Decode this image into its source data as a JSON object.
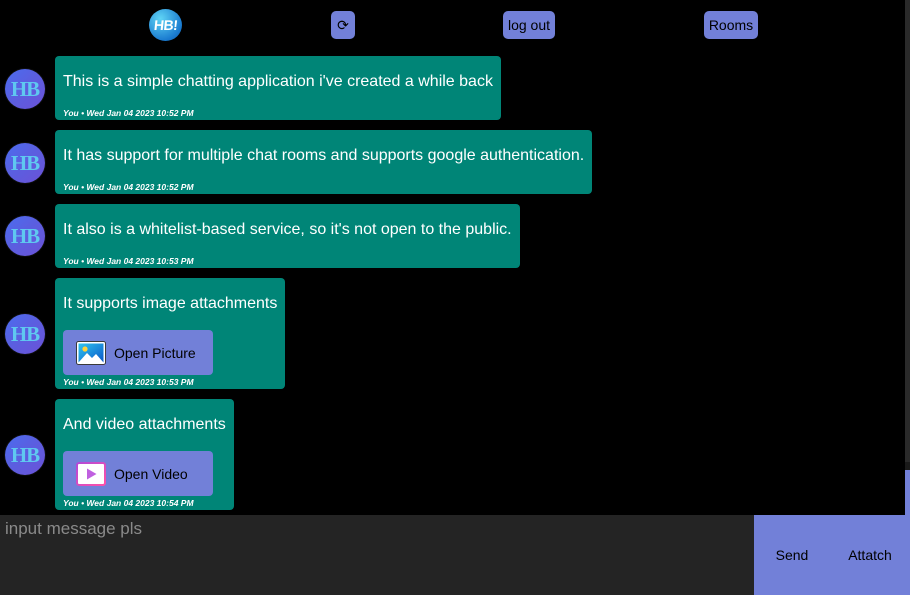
{
  "topbar": {
    "logo_text": "HB!",
    "refresh_glyph": "⟳",
    "logout_label": "log out",
    "rooms_label": "Rooms"
  },
  "avatar_text": "HB",
  "messages": [
    {
      "text": "This is a simple chatting application i've created a while back",
      "meta": "You • Wed Jan 04 2023 10:52 PM"
    },
    {
      "text": "It has support for multiple chat rooms and supports google authentication.",
      "meta": "You • Wed Jan 04 2023 10:52 PM"
    },
    {
      "text": "It also is a whitelist-based service, so it's not open to the public.",
      "meta": "You • Wed Jan 04 2023 10:53 PM"
    },
    {
      "text": "It supports image attachments",
      "meta": "You • Wed Jan 04 2023 10:53 PM",
      "attachment": {
        "label": "Open Picture",
        "icon": "image-icon"
      }
    },
    {
      "text": "And video attachments",
      "meta": "You • Wed Jan 04 2023 10:54 PM",
      "attachment": {
        "label": "Open Video",
        "icon": "video-icon"
      }
    }
  ],
  "composer": {
    "placeholder": "input message pls",
    "send_label": "Send",
    "attach_label": "Attatch"
  },
  "colors": {
    "accent": "#7280d8",
    "bubble": "#008577",
    "background": "#000000",
    "composer": "#242424"
  }
}
